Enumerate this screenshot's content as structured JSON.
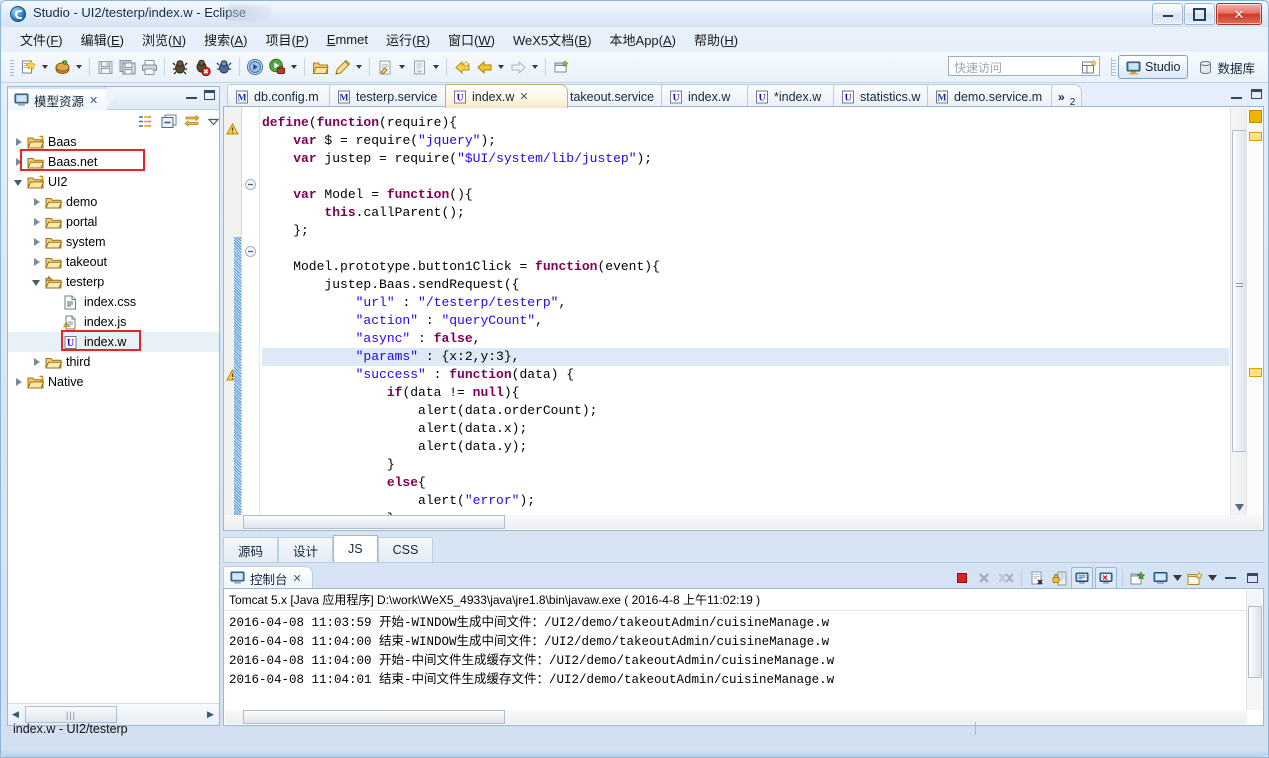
{
  "window": {
    "title": "Studio - UI2/testerp/index.w - Eclipse",
    "buttons": {
      "minimize": "minimize-button",
      "maximize": "maximize-button",
      "close": "✕"
    }
  },
  "menubar": {
    "items": [
      {
        "label": "文件(F)",
        "mnemonic": "F"
      },
      {
        "label": "编辑(E)",
        "mnemonic": "E"
      },
      {
        "label": "浏览(N)",
        "mnemonic": "N"
      },
      {
        "label": "搜索(A)",
        "mnemonic": "A"
      },
      {
        "label": "项目(P)",
        "mnemonic": "P"
      },
      {
        "label": "Emmet",
        "mnemonic": "E"
      },
      {
        "label": "运行(R)",
        "mnemonic": "R"
      },
      {
        "label": "窗口(W)",
        "mnemonic": "W"
      },
      {
        "label": "WeX5文档(B)",
        "mnemonic": "B"
      },
      {
        "label": "本地App(A)",
        "mnemonic": "A"
      },
      {
        "label": "帮助(H)",
        "mnemonic": "H"
      }
    ]
  },
  "toolbar": {
    "quick_access_placeholder": "快速访问",
    "perspectives": [
      {
        "label": "Studio",
        "icon": "monitor-icon",
        "active": true
      },
      {
        "label": "数据库",
        "icon": "database-icon",
        "active": false
      }
    ],
    "open_perspective_icon": "open-perspective-icon",
    "icons": [
      "new-wizard-icon",
      "new-wizard-dropdown",
      "package-icon",
      "package-dropdown",
      "save-icon",
      "save-all-icon",
      "print-icon",
      "debug-ant-icon",
      "debug-ant-error-icon",
      "ant-build-icon",
      "run-last-icon",
      "run-icon",
      "run-dropdown",
      "open-type-icon",
      "pencil-icon",
      "pencil-dropdown",
      "next-annotation-icon",
      "next-annotation-dropdown",
      "previous-edit-icon",
      "previous-edit-dropdown",
      "back-icon",
      "forward-icon",
      "forward-dropdown",
      "next-icon",
      "next-dropdown",
      "new-window-icon"
    ]
  },
  "explorer": {
    "tab_title": "模型资源",
    "tab_close": "✕",
    "toolbar_icons": [
      "link-with-editor-icon",
      "collapse-all-icon",
      "sync-icon",
      "view-menu-icon"
    ],
    "tree": [
      {
        "label": "Baas",
        "depth": 0,
        "twist": "closed",
        "icon": "project-icon",
        "selected": false,
        "highlight": false
      },
      {
        "label": "Baas.net",
        "depth": 0,
        "twist": "closed",
        "icon": "folder-icon",
        "selected": false,
        "highlight": true
      },
      {
        "label": "UI2",
        "depth": 0,
        "twist": "open",
        "icon": "project-icon",
        "selected": false,
        "highlight": false
      },
      {
        "label": "demo",
        "depth": 1,
        "twist": "closed",
        "icon": "folder-icon",
        "selected": false,
        "highlight": false
      },
      {
        "label": "portal",
        "depth": 1,
        "twist": "closed",
        "icon": "folder-icon",
        "selected": false,
        "highlight": false
      },
      {
        "label": "system",
        "depth": 1,
        "twist": "closed",
        "icon": "folder-icon",
        "selected": false,
        "highlight": false
      },
      {
        "label": "takeout",
        "depth": 1,
        "twist": "closed",
        "icon": "folder-icon",
        "selected": false,
        "highlight": false
      },
      {
        "label": "testerp",
        "depth": 1,
        "twist": "open",
        "icon": "folder-warning-icon",
        "selected": false,
        "highlight": false
      },
      {
        "label": "index.css",
        "depth": 2,
        "twist": "none",
        "icon": "css-file-icon",
        "selected": false,
        "highlight": false
      },
      {
        "label": "index.js",
        "depth": 2,
        "twist": "none",
        "icon": "js-file-warning-icon",
        "selected": false,
        "highlight": false
      },
      {
        "label": "index.w",
        "depth": 2,
        "twist": "none",
        "icon": "w-file-icon",
        "selected": true,
        "highlight": true
      },
      {
        "label": "third",
        "depth": 1,
        "twist": "closed",
        "icon": "folder-icon",
        "selected": false,
        "highlight": false
      },
      {
        "label": "Native",
        "depth": 0,
        "twist": "closed",
        "icon": "project-icon",
        "selected": false,
        "highlight": false
      }
    ],
    "hscroll_grip": "|||"
  },
  "editor": {
    "tabs": [
      {
        "label": "db.config.m",
        "icon": "m-file-icon",
        "active": false,
        "dirty": false
      },
      {
        "label": "testerp.service",
        "icon": "m-file-icon",
        "active": false,
        "dirty": false
      },
      {
        "label": "index.w",
        "icon": "w-file-icon",
        "active": true,
        "dirty": false,
        "close": "✕"
      },
      {
        "label": "takeout.service",
        "icon": "m-file-icon",
        "active": false,
        "dirty": false
      },
      {
        "label": "index.w",
        "icon": "w-file-icon",
        "active": false,
        "dirty": false
      },
      {
        "label": "*index.w",
        "icon": "w-file-icon",
        "active": false,
        "dirty": true
      },
      {
        "label": "statistics.w",
        "icon": "w-file-icon",
        "active": false,
        "dirty": false
      },
      {
        "label": "demo.service.m",
        "icon": "m-file-icon",
        "active": false,
        "dirty": false
      }
    ],
    "overflow_label": "»",
    "overflow_count": "2",
    "minimize_icon": "minimize-icon",
    "maximize_icon": "maximize-icon",
    "code_lines": [
      {
        "text": "define(function(require){",
        "highlight": false
      },
      {
        "text": "    var $ = require(\"jquery\");",
        "highlight": false
      },
      {
        "text": "    var justep = require(\"$UI/system/lib/justep\");",
        "highlight": false
      },
      {
        "text": "",
        "highlight": false
      },
      {
        "text": "    var Model = function(){",
        "highlight": false
      },
      {
        "text": "        this.callParent();",
        "highlight": false
      },
      {
        "text": "    };",
        "highlight": false
      },
      {
        "text": "",
        "highlight": false
      },
      {
        "text": "    Model.prototype.button1Click = function(event){",
        "highlight": false
      },
      {
        "text": "        justep.Baas.sendRequest({",
        "highlight": false
      },
      {
        "text": "            \"url\" : \"/testerp/testerp\",",
        "highlight": false
      },
      {
        "text": "            \"action\" : \"queryCount\",",
        "highlight": false
      },
      {
        "text": "            \"async\" : false,",
        "highlight": false
      },
      {
        "text": "            \"params\" : {x:2,y:3},",
        "highlight": true
      },
      {
        "text": "            \"success\" : function(data) {",
        "highlight": false
      },
      {
        "text": "                if(data != null){",
        "highlight": false
      },
      {
        "text": "                    alert(data.orderCount);",
        "highlight": false
      },
      {
        "text": "                    alert(data.x);",
        "highlight": false
      },
      {
        "text": "                    alert(data.y);",
        "highlight": false
      },
      {
        "text": "                }",
        "highlight": false
      },
      {
        "text": "                else{",
        "highlight": false
      },
      {
        "text": "                    alert(\"error\");",
        "highlight": false
      },
      {
        "text": "                }",
        "highlight": false
      },
      {
        "text": "            }",
        "highlight": false
      }
    ],
    "mode_tabs": [
      {
        "label": "源码",
        "active": false
      },
      {
        "label": "设计",
        "active": false
      },
      {
        "label": "JS",
        "active": true
      },
      {
        "label": "CSS",
        "active": false
      }
    ]
  },
  "console": {
    "tab_title": "控制台",
    "tab_close": "✕",
    "toolbar_icons": [
      "terminate-icon",
      "remove-launch-icon",
      "remove-all-launches-icon",
      "clear-console-icon",
      "scroll-lock-icon",
      "show-console-on-output-icon",
      "show-console-on-error-icon",
      "pin-console-icon",
      "display-selected-console-icon",
      "display-selected-dropdown",
      "open-console-icon",
      "open-console-dropdown",
      "minimize-icon",
      "maximize-icon"
    ],
    "header": "Tomcat 5.x [Java 应用程序] D:\\work\\WeX5_4933\\java\\jre1.8\\bin\\javaw.exe ( 2016-4-8 上午11:02:19 )",
    "lines": [
      "2016-04-08 11:03:59 开始-WINDOW生成中间文件：/UI2/demo/takeoutAdmin/cuisineManage.w",
      "2016-04-08 11:04:00 结束-WINDOW生成中间文件：/UI2/demo/takeoutAdmin/cuisineManage.w",
      "2016-04-08 11:04:00 开始-中间文件生成缓存文件：/UI2/demo/takeoutAdmin/cuisineManage.w",
      "2016-04-08 11:04:01 结束-中间文件生成缓存文件：/UI2/demo/takeoutAdmin/cuisineManage.w"
    ]
  },
  "statusbar": {
    "text": "index.w - UI2/testerp"
  },
  "colors": {
    "accent": "#5b9bd5",
    "highlight_box": "#e8232a",
    "keyword": "#7f0055",
    "string": "#2a00ff",
    "selection": "#dceaf7"
  }
}
